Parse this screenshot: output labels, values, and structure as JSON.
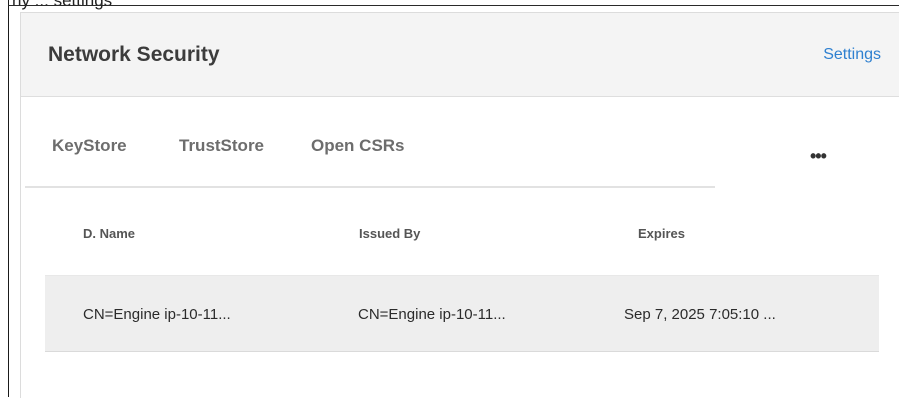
{
  "background_caption": "ny ... settings",
  "panel": {
    "title": "Network Security",
    "settings_label": "Settings"
  },
  "tabs": [
    {
      "label": "KeyStore"
    },
    {
      "label": "TrustStore"
    },
    {
      "label": "Open CSRs"
    }
  ],
  "more_label": "•••",
  "table": {
    "columns": [
      "D. Name",
      "Issued By",
      "Expires"
    ],
    "rows": [
      [
        "CN=Engine ip-10-11...",
        "CN=Engine ip-10-11...",
        "Sep 7, 2025 7:05:10 ..."
      ]
    ]
  }
}
